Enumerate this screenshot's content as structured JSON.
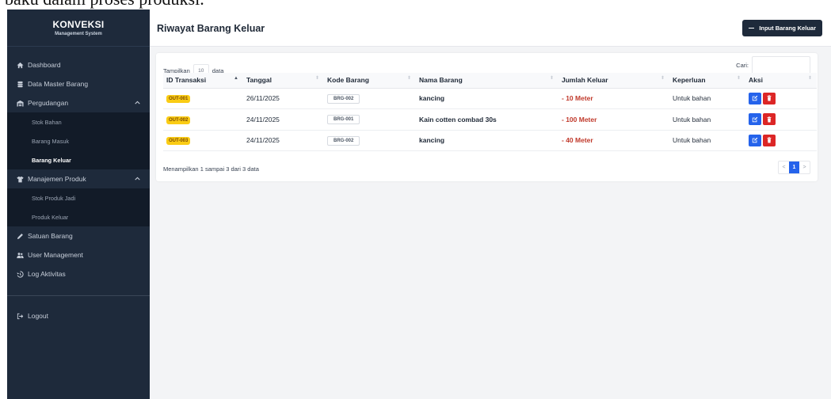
{
  "top_strip_text": "baku dalam proses produksi.",
  "brand": {
    "title": "KONVEKSI",
    "subtitle": "Management System"
  },
  "sidebar": {
    "items": [
      {
        "label": "Dashboard"
      },
      {
        "label": "Data Master Barang"
      },
      {
        "label": "Pergudangan",
        "submenu": [
          "Stok Bahan",
          "Barang Masuk",
          "Barang Keluar"
        ]
      },
      {
        "label": "Manajemen Produk",
        "submenu": [
          "Stok Produk Jadi",
          "Produk Keluar"
        ]
      },
      {
        "label": "Satuan Barang"
      },
      {
        "label": "User Management"
      },
      {
        "label": "Log Aktivitas"
      }
    ],
    "logout": "Logout"
  },
  "header": {
    "title": "Riwayat Barang Keluar",
    "input_button": "Input Barang Keluar"
  },
  "controls": {
    "show_prefix": "Tampilkan",
    "show_value": "10",
    "show_suffix": "data",
    "search_label": "Cari:"
  },
  "table": {
    "columns": [
      "ID Transaksi",
      "Tanggal",
      "Kode Barang",
      "Nama Barang",
      "Jumlah Keluar",
      "Keperluan",
      "Aksi"
    ],
    "rows": [
      {
        "id": "OUT-001",
        "tanggal": "26/11/2025",
        "kode": "BRG-002",
        "nama": "kancing",
        "jumlah": "- 10 Meter",
        "keperluan": "Untuk bahan"
      },
      {
        "id": "OUT-002",
        "tanggal": "24/11/2025",
        "kode": "BRG-001",
        "nama": "Kain cotten combad 30s",
        "jumlah": "- 100 Meter",
        "keperluan": "Untuk bahan"
      },
      {
        "id": "OUT-003",
        "tanggal": "24/11/2025",
        "kode": "BRG-002",
        "nama": "kancing",
        "jumlah": "- 40 Meter",
        "keperluan": "Untuk bahan"
      }
    ]
  },
  "footer": {
    "info": "Menampilkan 1 sampai 3 dari 3 data",
    "pager": {
      "prev": "<",
      "current": "1",
      "next": ">"
    }
  },
  "colors": {
    "sidebar": "#1e2a3b",
    "submenu": "#121b28",
    "primary": "#2563eb",
    "danger": "#dc2626",
    "badge": "#facc15",
    "minus_text": "#c0392b"
  }
}
